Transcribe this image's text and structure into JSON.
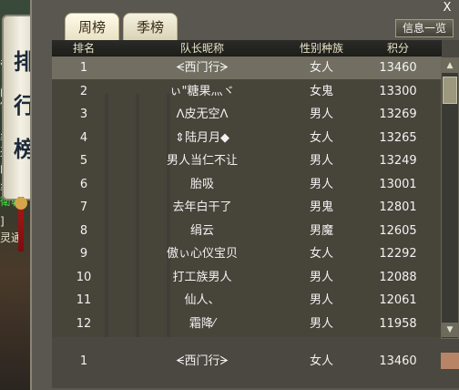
{
  "left_edge": [
    "帝",
    "门",
    "仙",
    "丝",
    "盗",
    "门",
    "丝络",
    "衛朝",
    "]",
    "灵通"
  ],
  "banner": {
    "chars": [
      "排",
      "行",
      "榜"
    ]
  },
  "tabs": [
    {
      "label": "周榜",
      "active": true
    },
    {
      "label": "季榜",
      "active": false
    }
  ],
  "info_button": "信息一览",
  "close": "X",
  "columns": [
    "排名",
    "队长昵称",
    "性别种族",
    "积分"
  ],
  "rows": [
    {
      "rank": "1",
      "name": "ᗕ西门行ᗒ",
      "race": "女人",
      "score": "13460",
      "selected": true
    },
    {
      "rank": "2",
      "name": "ぃ\"糖果灬ヾ",
      "race": "女鬼",
      "score": "13300"
    },
    {
      "rank": "3",
      "name": "ᐱ皮无空ᐱ",
      "race": "男人",
      "score": "13269"
    },
    {
      "rank": "4",
      "name": "⇕陆月月◆",
      "race": "女人",
      "score": "13265"
    },
    {
      "rank": "5",
      "name": "男人当仁不让",
      "race": "男人",
      "score": "13249"
    },
    {
      "rank": "6",
      "name": "胎吸",
      "race": "男人",
      "score": "13001"
    },
    {
      "rank": "7",
      "name": "去年白干了",
      "race": "男鬼",
      "score": "12801"
    },
    {
      "rank": "8",
      "name": "绢云",
      "race": "男魔",
      "score": "12605"
    },
    {
      "rank": "9",
      "name": "傲ぃ心仪宝贝",
      "race": "女人",
      "score": "12292"
    },
    {
      "rank": "10",
      "name": "打工族男人",
      "race": "男人",
      "score": "12088"
    },
    {
      "rank": "11",
      "name": "仙人、",
      "race": "男人",
      "score": "12061"
    },
    {
      "rank": "12",
      "name": "霜降⁄",
      "race": "男人",
      "score": "11958"
    }
  ],
  "my_rank": {
    "rank": "1",
    "name": "ᗕ西门行ᗒ",
    "race": "女人",
    "score": "13460"
  },
  "colors": {
    "panel": "#5a5750",
    "header": "#1d1d1a",
    "selected_row": "#969182",
    "tab": "#f5f2df"
  }
}
